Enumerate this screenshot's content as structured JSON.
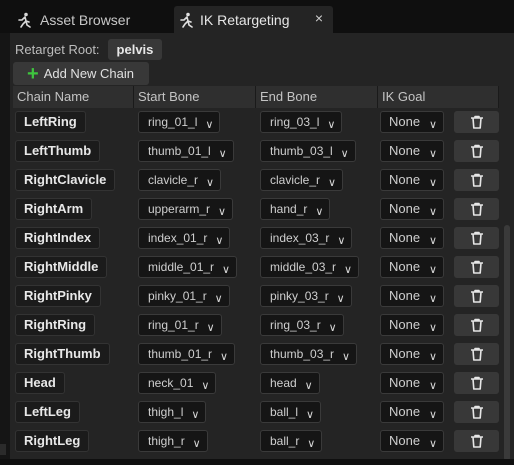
{
  "tabs": [
    {
      "label": "Asset Browser",
      "icon": "running-figure-icon",
      "active": false
    },
    {
      "label": "IK Retargeting",
      "icon": "running-figure-icon",
      "active": true,
      "close": "×"
    }
  ],
  "retarget_root": {
    "label": "Retarget Root:",
    "value": "pelvis"
  },
  "add_chain": {
    "label": "Add New Chain",
    "icon": "plus-icon",
    "icon_color": "#3ec43e"
  },
  "columns": [
    "Chain Name",
    "Start Bone",
    "End Bone",
    "IK Goal"
  ],
  "rows": [
    {
      "name": "LeftRing",
      "start": "ring_01_l",
      "end": "ring_03_l",
      "goal": "None"
    },
    {
      "name": "LeftThumb",
      "start": "thumb_01_l",
      "end": "thumb_03_l",
      "goal": "None"
    },
    {
      "name": "RightClavicle",
      "start": "clavicle_r",
      "end": "clavicle_r",
      "goal": "None"
    },
    {
      "name": "RightArm",
      "start": "upperarm_r",
      "end": "hand_r",
      "goal": "None"
    },
    {
      "name": "RightIndex",
      "start": "index_01_r",
      "end": "index_03_r",
      "goal": "None"
    },
    {
      "name": "RightMiddle",
      "start": "middle_01_r",
      "end": "middle_03_r",
      "goal": "None"
    },
    {
      "name": "RightPinky",
      "start": "pinky_01_r",
      "end": "pinky_03_r",
      "goal": "None"
    },
    {
      "name": "RightRing",
      "start": "ring_01_r",
      "end": "ring_03_r",
      "goal": "None"
    },
    {
      "name": "RightThumb",
      "start": "thumb_01_r",
      "end": "thumb_03_r",
      "goal": "None"
    },
    {
      "name": "Head",
      "start": "neck_01",
      "end": "head",
      "goal": "None"
    },
    {
      "name": "LeftLeg",
      "start": "thigh_l",
      "end": "ball_l",
      "goal": "None"
    },
    {
      "name": "RightLeg",
      "start": "thigh_r",
      "end": "ball_r",
      "goal": "None"
    }
  ],
  "icons": {
    "dropdown": "chevron-down-icon",
    "delete": "trash-icon"
  }
}
